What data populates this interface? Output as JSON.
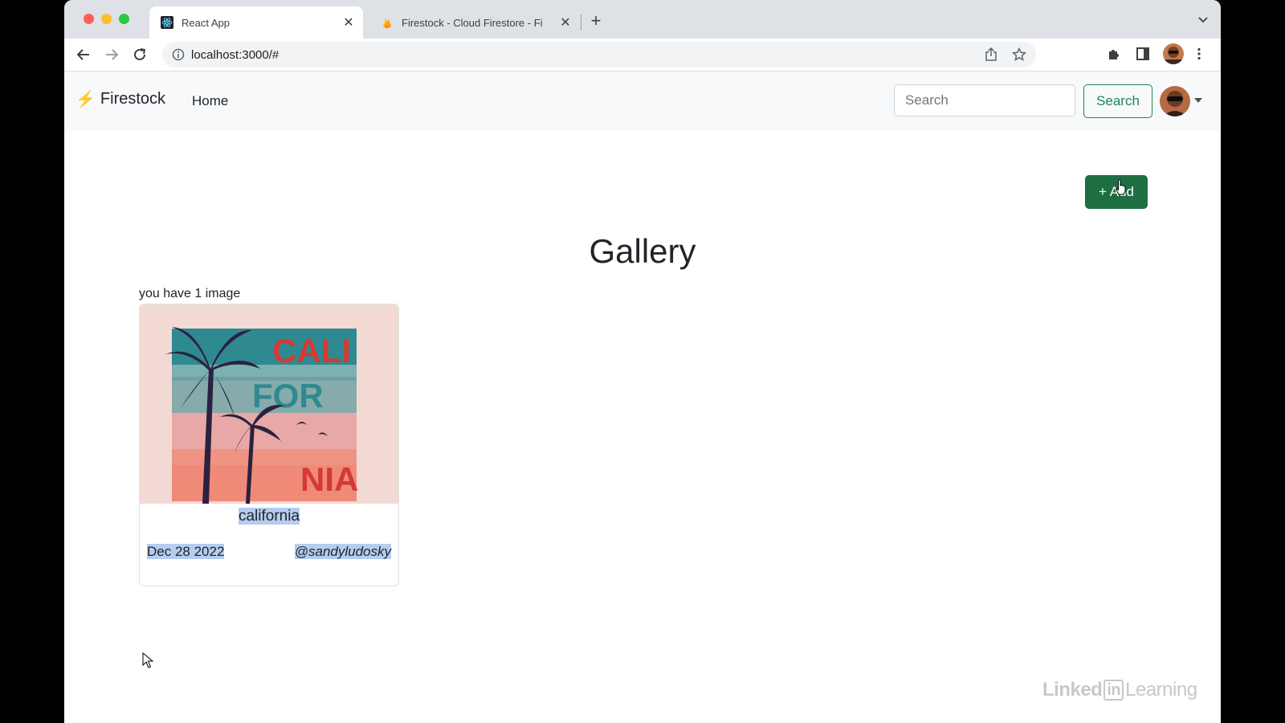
{
  "browser": {
    "tabs": [
      {
        "title": "React App",
        "favicon": "react-icon"
      },
      {
        "title": "Firestock - Cloud Firestore - Fi",
        "favicon": "firebase-icon"
      }
    ],
    "url": "localhost:3000/#"
  },
  "navbar": {
    "brand": "Firestock",
    "home_label": "Home",
    "search_placeholder": "Search",
    "search_button": "Search"
  },
  "main": {
    "add_button": "+ Add",
    "title": "Gallery",
    "count_text": "you have 1 image",
    "card": {
      "image_text": [
        "CALI",
        "FOR",
        "NIA"
      ],
      "title": "california",
      "date": "Dec 28 2022",
      "user": "@sandyludosky"
    }
  },
  "watermark": {
    "left": "Linked",
    "in": "in",
    "right": "Learning"
  },
  "colors": {
    "success": "#198754",
    "add_button": "#1d6f42",
    "navbar_bg": "#f8f9fa",
    "brand_bolt": "#f5b800",
    "selection": "#b4cdf0"
  }
}
